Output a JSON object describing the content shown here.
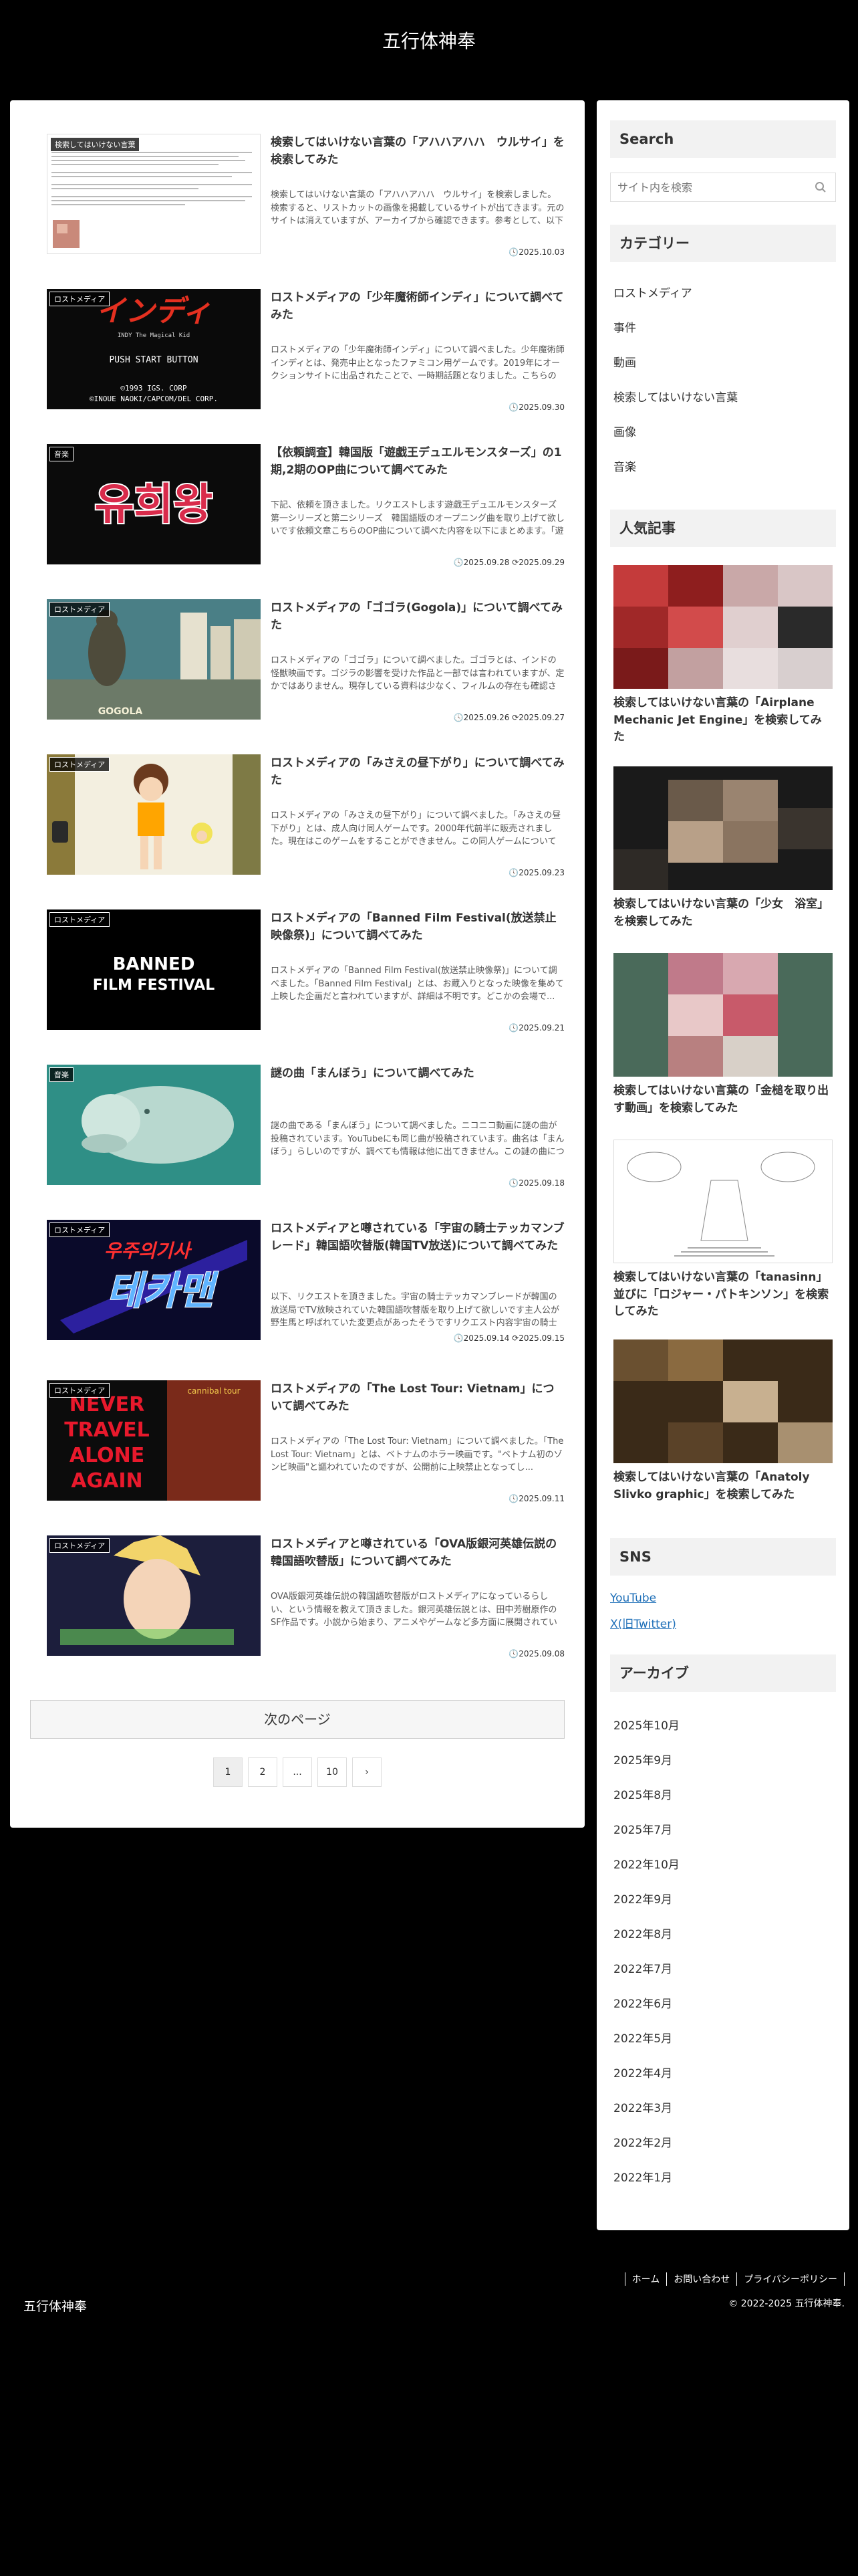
{
  "site": {
    "title": "五行体神奉"
  },
  "articles": [
    {
      "title": "検索してはいけない言葉の「アハハアハハ　ウルサイ」を検索してみた",
      "snippet": "検索してはいけない言葉の「アハハアハハ　ウルサイ」を検索しました。検索すると、リストカットの画像を掲載しているサイトが出てきます。元のサイトは消えていますが、アーカイブから確認できます。参考として、以下にURLを載せておきます。画像の内容上...",
      "badge": "検索してはいけない言葉",
      "date": "2025.10.03",
      "updated": ""
    },
    {
      "title": "ロストメディアの「少年魔術師インディ」について調べてみた",
      "snippet": "ロストメディアの「少年魔術師インディ」について調べました。少年魔術師インディとは、発売中止となったファミコン用ゲームです。2019年にオークションサイトに出品されたことで、一時期話題となりました。こちらのゲームについて調べた内容を以下にま...",
      "badge": "ロストメディア",
      "date": "2025.09.30",
      "updated": ""
    },
    {
      "title": "【依頼調査】韓国版「遊戯王デュエルモンスターズ」の1期,2期のOP曲について調べてみた",
      "snippet": "下記、依頼を頂きました。リクエストします遊戯王デュエルモンスターズ第一シリーズと第二シリーズ　韓国語版のオープニング曲を取り上げて欲しいです依頼文章こちらのOP曲について調べた内容を以下にまとめます。「遊戯王」1期,2期のOP曲の概要以下に...",
      "badge": "音楽",
      "date": "2025.09.29",
      "updated": "2025.09.28"
    },
    {
      "title": "ロストメディアの「ゴゴラ(Gogola)」について調べてみた",
      "snippet": "ロストメディアの「ゴゴラ」について調べました。ゴゴラとは、インドの怪獣映画です。ゴジラの影響を受けた作品と一部では言われていますが、定かではありません。現存している資料は少なく、フィルムの存在も確認されていません。こちらの映画について調べた...",
      "badge": "ロストメディア",
      "date": "2025.09.27",
      "updated": "2025.09.26"
    },
    {
      "title": "ロストメディアの「みさえの昼下がり」について調べてみた",
      "snippet": "ロストメディアの「みさえの昼下がり」について調べました。「みさえの昼下がり」とは、成人向け同人ゲームです。2000年代前半に販売されました。現在はこのゲームをすることができません。この同人ゲームについて調べた内容を以下にまとめます。「みさ...",
      "badge": "ロストメディア",
      "date": "2025.09.23",
      "updated": ""
    },
    {
      "title": "ロストメディアの「Banned Film Festival(放送禁止映像祭)」について調べてみた",
      "snippet": "ロストメディアの「Banned Film Festival(放送禁止映像祭)」について調べました。「Banned Film Festival」とは、お蔵入りとなった映像を集めて上映した企画だと言われていますが、詳細は不明です。どこかの会場で...",
      "badge": "ロストメディア",
      "date": "2025.09.21",
      "updated": ""
    },
    {
      "title": "謎の曲「まんぼう」について調べてみた",
      "snippet": "謎の曲である「まんぼう」について調べました。ニコニコ動画に謎の曲が投稿されています。YouTubeにも同じ曲が投稿されています。曲名は「まんぼう」らしいのですが、調べても情報は他に出てきません。この謎の曲について調べた内容を以下にまとめます...",
      "badge": "音楽",
      "date": "2025.09.18",
      "updated": ""
    },
    {
      "title": "ロストメディアと噂されている「宇宙の騎士テッカマンブレード」韓国語吹替版(韓国TV放送)について調べてみた",
      "snippet": "以下、リクエストを頂きました。宇宙の騎士テッカマンブレードが韓国の放送局でTV放映されていた韓国語吹替版を取り上げて欲しいです主人公が野生馬と呼ばれていた変更点があったそうですリクエスト内容宇宙の騎士テッカマンブレードとは、タツノコプロ制作...",
      "badge": "ロストメディア",
      "date": "2025.09.15",
      "updated": "2025.09.14"
    },
    {
      "title": "ロストメディアの「The Lost Tour: Vietnam」について調べてみた",
      "snippet": "ロストメディアの「The Lost Tour: Vietnam」について調べました。「The Lost Tour: Vietnam」とは、ベトナムのホラー映画です。\"ベトナム初のゾンビ映画\"と謳われていたのですが、公開前に上映禁止となってし...",
      "badge": "ロストメディア",
      "date": "2025.09.11",
      "updated": ""
    },
    {
      "title": "ロストメディアと噂されている「OVA版銀河英雄伝説の韓国語吹替版」について調べてみた",
      "snippet": "OVA版銀河英雄伝説の韓国語吹替版がロストメディアになっているらしい、という情報を教えて頂きました。銀河英雄伝説とは、田中芳樹原作のSF作品です。小説から始まり、アニメやゲームなど多方面に展開されています。海外進出もしており、その中の一つに...",
      "badge": "ロストメディア",
      "date": "2025.09.08",
      "updated": ""
    }
  ],
  "pagination": {
    "next_label": "次のページ",
    "pages": [
      "1",
      "2",
      "...",
      "10",
      "›"
    ]
  },
  "sidebar": {
    "search_heading": "Search",
    "search_placeholder": "サイト内を検索",
    "category_heading": "カテゴリー",
    "categories": [
      "ロストメディア",
      "事件",
      "動画",
      "検索してはいけない言葉",
      "画像",
      "音楽"
    ],
    "popular_heading": "人気記事",
    "popular": [
      "検索してはいけない言葉の「Airplane Mechanic Jet Engine」を検索してみた",
      "検索してはいけない言葉の「少女　浴室」を検索してみた",
      "検索してはいけない言葉の「金槌を取り出す動画」を検索してみた",
      "検索してはいけない言葉の「tanasinn」並びに「ロジャー・パトキンソン」を検索してみた",
      "検索してはいけない言葉の「Anatoly Slivko graphic」を検索してみた"
    ],
    "sns_heading": "SNS",
    "sns": [
      "YouTube",
      "X(旧Twitter)"
    ],
    "archive_heading": "アーカイブ",
    "archives": [
      "2025年10月",
      "2025年9月",
      "2025年8月",
      "2025年7月",
      "2022年10月",
      "2022年9月",
      "2022年8月",
      "2022年7月",
      "2022年6月",
      "2022年5月",
      "2022年4月",
      "2022年3月",
      "2022年2月",
      "2022年1月"
    ]
  },
  "footer": {
    "links": [
      "ホーム",
      "お問い合わせ",
      "プライバシーポリシー"
    ],
    "title": "五行体神奉",
    "copyright": "© 2022-2025 五行体神奉."
  },
  "thumbnails": {
    "indy_logo": "インディ",
    "indy_sub": "INDY  The Magical Kid",
    "indy_press": "PUSH  START  BUTTON",
    "indy_copy1": "©1993  IGS.  CORP",
    "indy_copy2": "©INOUE  NAOKI/CAPCOM/DEL  CORP.",
    "yugioh_logo": "유희왕",
    "gogola_caption": "GOGOLA",
    "banned_line1": "BANNED",
    "banned_line2": "FILM FESTIVAL",
    "tekkaman_top": "우주의기사",
    "tekkaman_main": "테카맨",
    "lost_tour_line1": "NEVER",
    "lost_tour_line2": "TRAVEL",
    "lost_tour_line3": "ALONE",
    "lost_tour_line4": "AGAIN",
    "lost_tour_small": "cannibal tour"
  }
}
